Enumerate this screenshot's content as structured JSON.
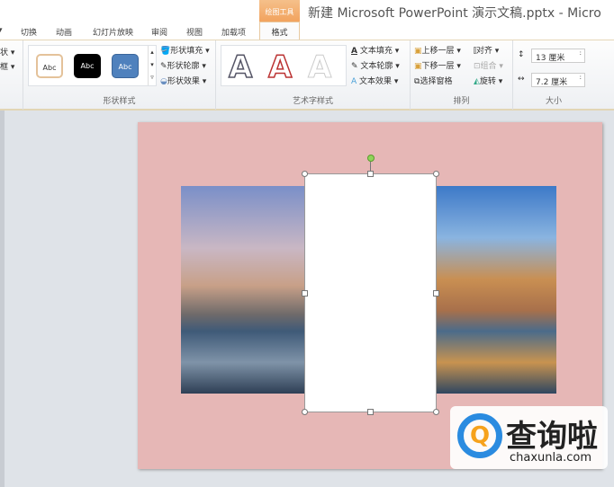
{
  "window": {
    "title": "新建 Microsoft PowerPoint 演示文稿.pptx - Micro",
    "context_tab": "绘图工具"
  },
  "tabs": [
    "切换",
    "动画",
    "幻灯片放映",
    "审阅",
    "视图",
    "加载项",
    "格式"
  ],
  "ribbon": {
    "left_cut": [
      "状 ▾",
      "框 ▾"
    ],
    "shape_styles": {
      "label": "形状样式",
      "presets": [
        "Abc",
        "Abc",
        "Abc"
      ],
      "fill": "形状填充",
      "outline": "形状轮廓",
      "effects": "形状效果"
    },
    "wordart": {
      "label": "艺术字样式",
      "text_fill": "文本填充",
      "text_outline": "文本轮廓",
      "text_effects": "文本效果"
    },
    "arrange": {
      "label": "排列",
      "bring_forward": "上移一层",
      "send_backward": "下移一层",
      "selection_pane": "选择窗格",
      "align": "对齐",
      "group": "组合",
      "rotate": "旋转"
    },
    "size": {
      "label": "大小",
      "height": "13 厘米",
      "width": "7.2 厘米"
    }
  },
  "watermark": {
    "cn": "查询啦",
    "en": "chaxunla.com"
  }
}
